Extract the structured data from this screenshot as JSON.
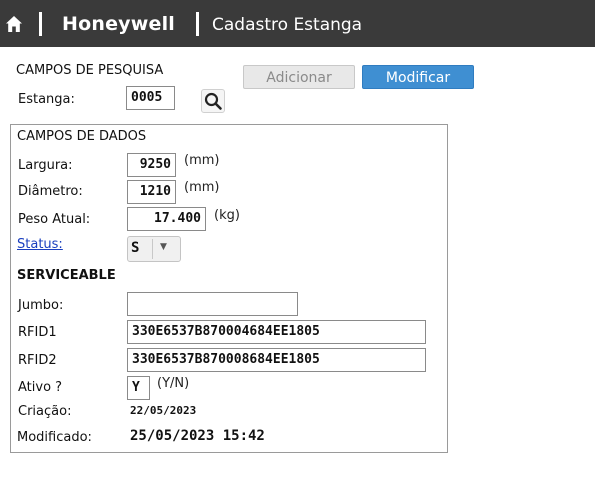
{
  "header": {
    "brand": "Honeywell",
    "title": "Cadastro Estanga",
    "home_icon": "home-icon"
  },
  "search": {
    "section_title": "CAMPOS DE PESQUISA",
    "estanga_label": "Estanga:",
    "estanga_value": "0005",
    "search_icon": "search-icon"
  },
  "buttons": {
    "add_label": "Adicionar",
    "modify_label": "Modificar"
  },
  "data_section": {
    "title": "CAMPOS DE DADOS",
    "largura_label": "Largura:",
    "largura_value": "9250",
    "largura_unit": "(mm)",
    "diametro_label": "Diâmetro:",
    "diametro_value": "1210",
    "diametro_unit": "(mm)",
    "peso_label": "Peso Atual:",
    "peso_value": "17.400",
    "peso_unit": "(kg)",
    "status_label": "Status:",
    "status_value": "S",
    "status_text": "SERVICEABLE",
    "jumbo_label": "Jumbo:",
    "jumbo_value": "",
    "rfid1_label": "RFID1",
    "rfid1_value": "330E6537B870004684EE1805",
    "rfid2_label": "RFID2",
    "rfid2_value": "330E6537B870008684EE1805",
    "ativo_label": "Ativo ?",
    "ativo_value": "Y",
    "ativo_unit": "(Y/N)",
    "criacao_label": "Criação:",
    "criacao_value": "22/05/2023",
    "modificado_label": "Modificado:",
    "modificado_value": "25/05/2023 15:42"
  },
  "colors": {
    "titlebar": "#3a3a3a",
    "primary_button": "#3f8fd2",
    "link": "#1a3fbf"
  }
}
